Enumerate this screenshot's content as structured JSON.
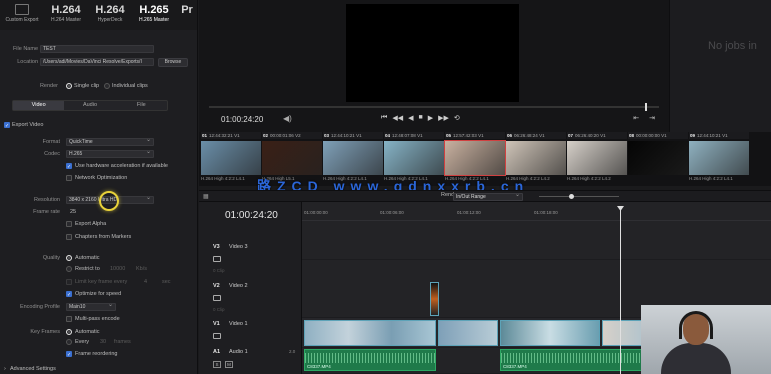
{
  "presets": [
    {
      "big": "",
      "small": "Custom Export",
      "icon": "custom-export-icon"
    },
    {
      "big": "H.264",
      "small": "H.264 Master"
    },
    {
      "big": "H.264",
      "small": "HyperDeck"
    },
    {
      "big": "H.265",
      "small": "H.265 Master"
    },
    {
      "big": "Pr",
      "small": ""
    }
  ],
  "file": {
    "name_label": "File Name",
    "name_value": "TEST",
    "location_label": "Location",
    "location_value": "/Users/adi/Movies/DaVinci Resolve/Exports/I",
    "browse": "Browse"
  },
  "render": {
    "label": "Render",
    "single": "Single clip",
    "individual": "Individual clips"
  },
  "tabs": [
    "Video",
    "Audio",
    "File"
  ],
  "video": {
    "export_video": "Export Video",
    "format_label": "Format",
    "format_value": "QuickTime",
    "codec_label": "Codec",
    "codec_value": "H.265",
    "hw_accel": "Use hardware acceleration if available",
    "net_opt": "Network Optimization",
    "resolution_label": "Resolution",
    "resolution_value": "3840 x 2160 Ultra HD",
    "framerate_label": "Frame rate",
    "framerate_value": "25",
    "export_alpha": "Export Alpha",
    "chapters": "Chapters from Markers",
    "quality_label": "Quality",
    "q_auto": "Automatic",
    "q_restrict": "Restrict to",
    "q_kbps_val": "10000",
    "q_kbps_unit": "Kb/s",
    "q_limit": "Limit key frame every",
    "q_limit_val": "4",
    "q_limit_unit": "sec",
    "optimize_speed": "Optimize for speed",
    "enc_profile_label": "Encoding Profile",
    "enc_profile_value": "Main10",
    "multipass": "Multi-pass encode",
    "keyframes_label": "Key Frames",
    "kf_auto": "Automatic",
    "kf_every": "Every",
    "kf_every_val": "30",
    "kf_frames": "frames",
    "frame_reorder": "Frame reordering",
    "advanced": "Advanced Settings"
  },
  "viewer": {
    "timecode": "01:00:24:20",
    "transport": [
      "⏮",
      "◀◀",
      "◀",
      "■",
      "▶",
      "▶▶",
      "⟲"
    ],
    "io": [
      "⇤",
      "⇥"
    ]
  },
  "queue": {
    "empty_text": "No jobs in"
  },
  "clips": [
    {
      "num": "01",
      "tc": "12:44:32:21",
      "track": "V1",
      "foot": "H.264 High 4:2:2 L4.1",
      "color": "#6a8ea8"
    },
    {
      "num": "02",
      "tc": "00:00:01:06",
      "track": "V2",
      "foot": "H.264 High L5.1",
      "color": "#3a2016"
    },
    {
      "num": "03",
      "tc": "12:44:10:21",
      "track": "V1",
      "foot": "H.264 High 4:2:2 L4.1",
      "color": "#7fa0b8"
    },
    {
      "num": "04",
      "tc": "12:48:07:08",
      "track": "V1",
      "foot": "H.264 High 4:2:2 L4.1",
      "color": "#86b3c6"
    },
    {
      "num": "05",
      "tc": "12:57:42:03",
      "track": "V1",
      "foot": "H.264 High 4:2:2 L4.1",
      "color": "#c9b1a0"
    },
    {
      "num": "06",
      "tc": "06:26:48:24",
      "track": "V1",
      "foot": "H.264 High 4:2:2 L4.2",
      "color": "#cfc4b8"
    },
    {
      "num": "07",
      "tc": "06:26:40:20",
      "track": "V1",
      "foot": "H.264 High 4:2:2 L4.2",
      "color": "#d6d0c9"
    },
    {
      "num": "08",
      "tc": "00:00:00:00",
      "track": "V1",
      "foot": "",
      "color": "#050505"
    },
    {
      "num": "09",
      "tc": "12:44:10:21",
      "track": "V1",
      "foot": "H.264 High 4:2:2 L4.1",
      "color": "#8fb1c0"
    }
  ],
  "watermark": "路ZCD www.qdnxxrb.cn",
  "timeline": {
    "render_label": "Render",
    "range_value": "In/Out Range",
    "timecode": "01:00:24:20",
    "ruler": [
      "01:00:00:00",
      "01:00:06:00",
      "01:00:12:00",
      "01:00:18:00"
    ],
    "tracks": [
      {
        "id": "V3",
        "name": "Video 3",
        "clips": "0 Clip"
      },
      {
        "id": "V2",
        "name": "Video 2",
        "clips": "0 Clip"
      },
      {
        "id": "V1",
        "name": "Video 1",
        "clips": "9 Clips"
      },
      {
        "id": "A1",
        "name": "Audio 1",
        "clips": "2.0"
      }
    ],
    "audio_clip_name": "C8337.MP4"
  },
  "colors": {
    "accent_blue": "#3a6fd0",
    "clip_teal": "#2f6f8a",
    "audio_green": "#1f7a4a",
    "highlight_yellow": "#e8d23a",
    "selected_red": "#d04040"
  }
}
